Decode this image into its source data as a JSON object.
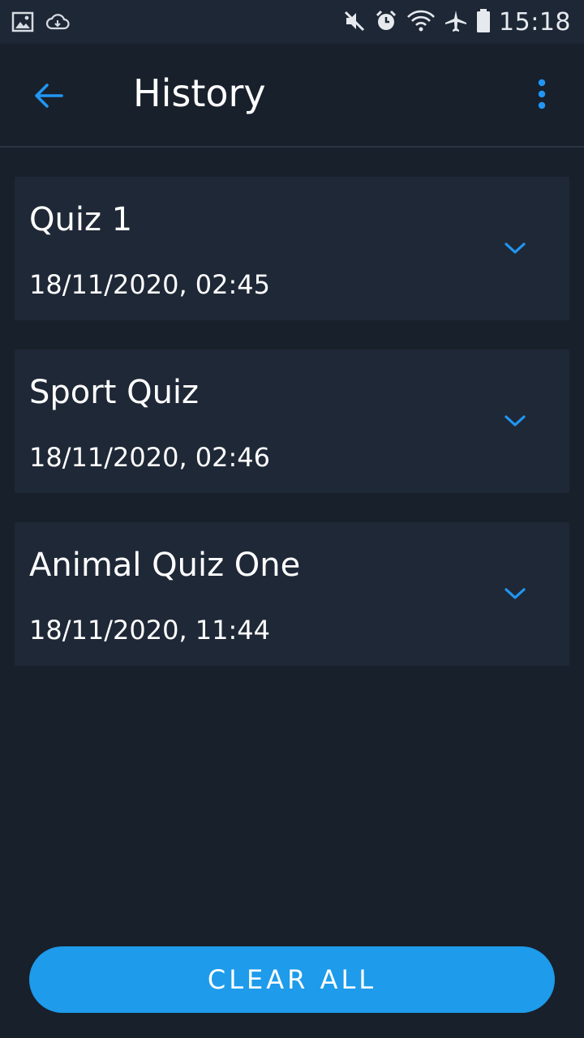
{
  "status_bar": {
    "time": "15:18",
    "left_icons": [
      "image-icon",
      "cloud-sync-icon"
    ],
    "right_icons": [
      "mute-icon",
      "alarm-icon",
      "wifi-icon",
      "airplane-icon",
      "battery-icon"
    ]
  },
  "appbar": {
    "title": "History",
    "back_icon": "arrow-left-icon",
    "menu_icon": "more-vert-icon"
  },
  "history": [
    {
      "title": "Quiz 1",
      "date": "18/11/2020, 02:45"
    },
    {
      "title": "Sport Quiz",
      "date": "18/11/2020, 02:46"
    },
    {
      "title": "Animal Quiz One",
      "date": "18/11/2020, 11:44"
    }
  ],
  "footer": {
    "clear_label": "CLEAR ALL"
  },
  "colors": {
    "background": "#18202b",
    "card": "#1f2836",
    "accent": "#1e9bea",
    "text": "#ffffff"
  }
}
